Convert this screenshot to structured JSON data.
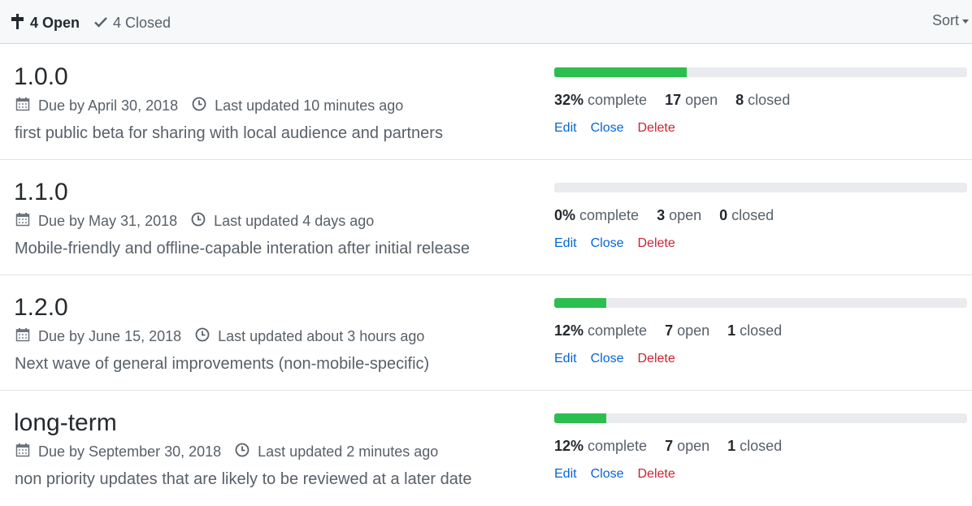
{
  "header": {
    "open_label": "4 Open",
    "closed_label": "4 Closed",
    "sort_label": "Sort"
  },
  "milestones": [
    {
      "title": "1.0.0",
      "due": "Due by April 30, 2018",
      "updated": "Last updated 10 minutes ago",
      "description": "first public beta for sharing with local audience and partners",
      "progress": 0.32,
      "percent": "32%",
      "percent_label": "complete",
      "open": "17",
      "open_label": "open",
      "closed": "8",
      "closed_label": "closed"
    },
    {
      "title": "1.1.0",
      "due": "Due by May 31, 2018",
      "updated": "Last updated 4 days ago",
      "description": "Mobile-friendly and offline-capable interation after initial release",
      "progress": 0.0,
      "percent": "0%",
      "percent_label": "complete",
      "open": "3",
      "open_label": "open",
      "closed": "0",
      "closed_label": "closed"
    },
    {
      "title": "1.2.0",
      "due": "Due by June 15, 2018",
      "updated": "Last updated about 3 hours ago",
      "description": "Next wave of general improvements (non-mobile-specific)",
      "progress": 0.125,
      "percent": "12%",
      "percent_label": "complete",
      "open": "7",
      "open_label": "open",
      "closed": "1",
      "closed_label": "closed"
    },
    {
      "title": "long-term",
      "due": "Due by September 30, 2018",
      "updated": "Last updated 2 minutes ago",
      "description": "non priority updates that are likely to be reviewed at a later date",
      "progress": 0.125,
      "percent": "12%",
      "percent_label": "complete",
      "open": "7",
      "open_label": "open",
      "closed": "1",
      "closed_label": "closed"
    }
  ],
  "actions": {
    "edit": "Edit",
    "close": "Close",
    "delete": "Delete"
  },
  "colors": {
    "progress_fill": "#2cbe4e",
    "link": "#0366d6",
    "danger": "#cb2431"
  },
  "icons": {
    "open": "milestone-icon",
    "closed": "check-icon",
    "due": "calendar-icon",
    "updated": "clock-icon"
  }
}
